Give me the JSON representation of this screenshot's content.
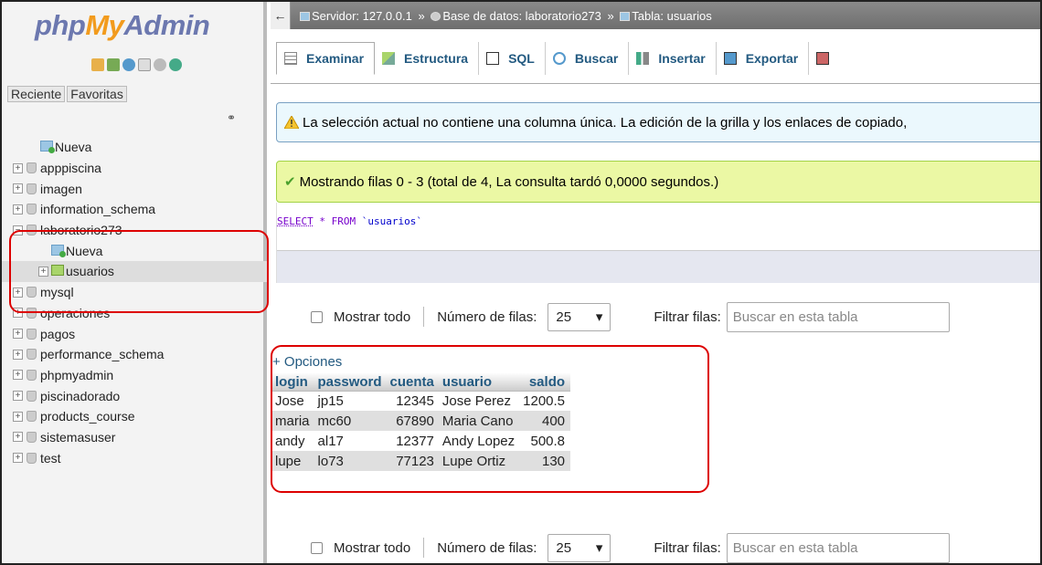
{
  "logo": {
    "php": "php",
    "my": "My",
    "admin": "Admin"
  },
  "sidebar": {
    "tab_reciente": "Reciente",
    "tab_favoritas": "Favoritas",
    "tree": [
      {
        "label": "Nueva",
        "type": "new",
        "expander": ""
      },
      {
        "label": "apppiscina",
        "type": "db",
        "expander": "+"
      },
      {
        "label": "imagen",
        "type": "db",
        "expander": "+"
      },
      {
        "label": "information_schema",
        "type": "db",
        "expander": "+"
      },
      {
        "label": "laboratorio273",
        "type": "db",
        "expander": "−"
      },
      {
        "label": "Nueva",
        "type": "child-new",
        "expander": ""
      },
      {
        "label": "usuarios",
        "type": "child-table",
        "expander": "+"
      },
      {
        "label": "mysql",
        "type": "db",
        "expander": "+"
      },
      {
        "label": "operaciones",
        "type": "db",
        "expander": "+"
      },
      {
        "label": "pagos",
        "type": "db",
        "expander": "+"
      },
      {
        "label": "performance_schema",
        "type": "db",
        "expander": "+"
      },
      {
        "label": "phpmyadmin",
        "type": "db",
        "expander": "+"
      },
      {
        "label": "piscinadorado",
        "type": "db",
        "expander": "+"
      },
      {
        "label": "products_course",
        "type": "db",
        "expander": "+"
      },
      {
        "label": "sistemasuser",
        "type": "db",
        "expander": "+"
      },
      {
        "label": "test",
        "type": "db",
        "expander": "+"
      }
    ]
  },
  "breadcrumb": {
    "server": "Servidor: 127.0.0.1",
    "database": "Base de datos: laboratorio273",
    "table": "Tabla: usuarios",
    "sep": "»"
  },
  "menu": {
    "examinar": "Examinar",
    "estructura": "Estructura",
    "sql": "SQL",
    "buscar": "Buscar",
    "insertar": "Insertar",
    "exportar": "Exportar"
  },
  "notice": "La selección actual no contiene una columna única. La edición de la grilla y los enlaces de copiado,",
  "success": "Mostrando filas 0 - 3 (total de 4, La consulta tardó 0,0000 segundos.)",
  "sql_query": {
    "kw1": "SELECT",
    "mid": " * FROM ",
    "table": "`usuarios`"
  },
  "controls": {
    "show_all": "Mostrar todo",
    "rows_label": "Número de filas:",
    "rows_value": "25",
    "filter_label": "Filtrar filas:",
    "filter_placeholder": "Buscar en esta tabla"
  },
  "options_link": "+ Opciones",
  "table": {
    "columns": [
      "login",
      "password",
      "cuenta",
      "usuario",
      "saldo"
    ],
    "rows": [
      [
        "Jose",
        "jp15",
        "12345",
        "Jose Perez",
        "1200.5"
      ],
      [
        "maria",
        "mc60",
        "67890",
        "Maria Cano",
        "400"
      ],
      [
        "andy",
        "al17",
        "12377",
        "Andy Lopez",
        "500.8"
      ],
      [
        "lupe",
        "lo73",
        "77123",
        "Lupe Ortiz",
        "130"
      ]
    ]
  },
  "colors": {
    "highlight": "#dd0000",
    "link": "#235a81",
    "notice_bg": "#ebf8fd",
    "success_bg": "#ebf8a4"
  }
}
